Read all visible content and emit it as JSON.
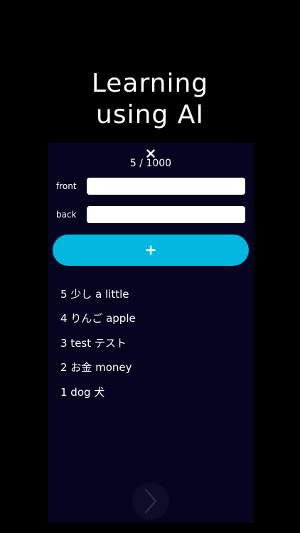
{
  "hero": {
    "line1": "Learning",
    "line2": "using AI"
  },
  "app": {
    "close_icon": "close-icon",
    "counter": "5 / 1000",
    "front_label": "front",
    "front_value": "",
    "back_label": "back",
    "back_value": "",
    "add_icon": "plus-icon",
    "next_icon": "chevron-right-icon",
    "cards": [
      "5 少し a little",
      "4 りんご apple",
      "3 test テスト",
      "2 お金 money",
      "1 dog 犬"
    ]
  },
  "colors": {
    "background": "#000000",
    "panel": "#05051f",
    "accent": "#00b7e0",
    "text": "#ffffff"
  }
}
